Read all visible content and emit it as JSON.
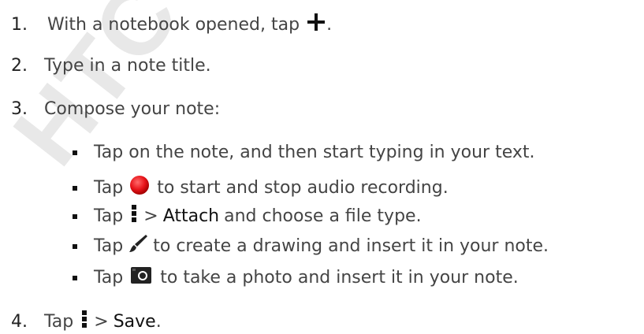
{
  "watermark": "HTC Con",
  "steps": [
    {
      "num": "1.",
      "pre": "With a notebook opened, tap",
      "post": "."
    },
    {
      "num": "2.",
      "text": "Type in a note title."
    },
    {
      "num": "3.",
      "text": "Compose your note:"
    },
    {
      "num": "4.",
      "pre": "Tap",
      "mid": ">",
      "bold": "Save",
      "post": "."
    }
  ],
  "substeps": [
    {
      "text": "Tap on the note, and then start typing in your text."
    },
    {
      "pre": "Tap",
      "post": "to start and stop audio recording."
    },
    {
      "pre": "Tap",
      "mid": ">",
      "bold": "Attach",
      "post": "and choose a file type."
    },
    {
      "pre": "Tap",
      "post": "to create a drawing and insert it in your note."
    },
    {
      "pre": "Tap",
      "post": "to take a photo and insert it in your note."
    }
  ],
  "icons": {
    "add": "plus-icon",
    "record": "record-icon",
    "menu": "menu-icon",
    "draw": "brush-icon",
    "camera": "camera-icon"
  },
  "colors": {
    "record": "#e8141a",
    "text": "#444444"
  }
}
